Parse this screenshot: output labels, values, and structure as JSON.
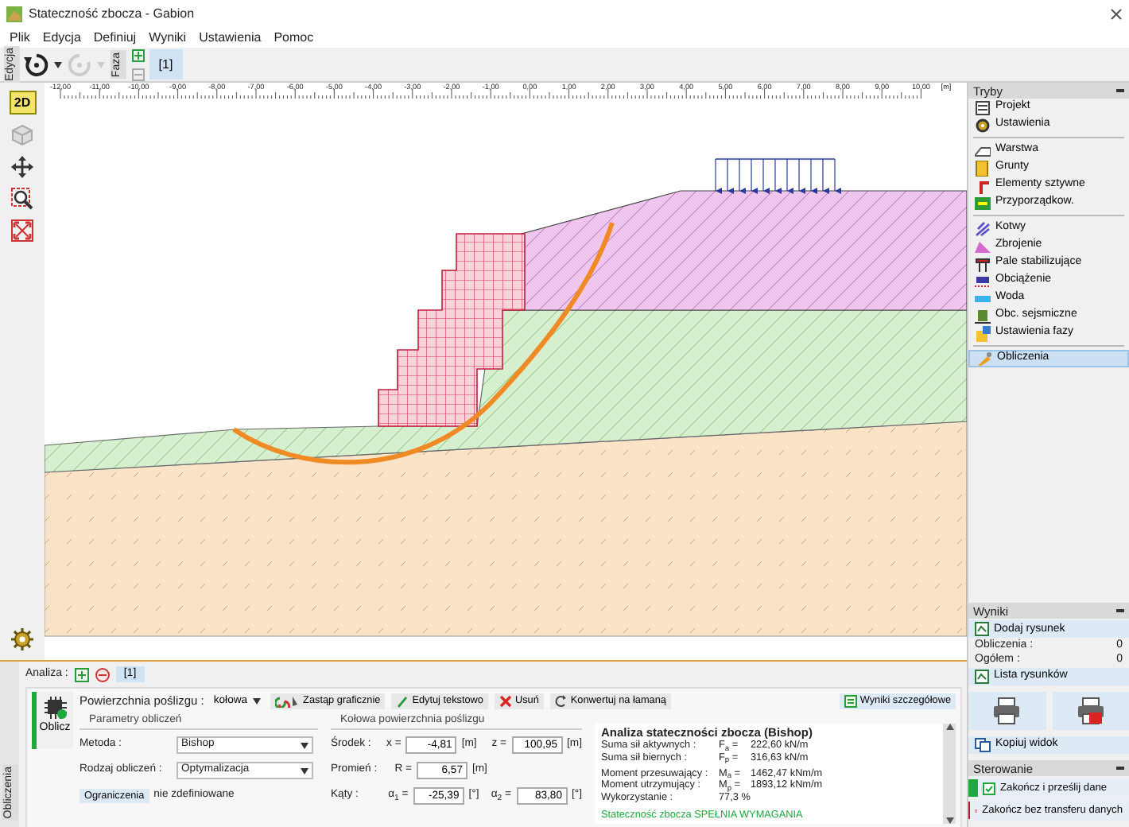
{
  "window": {
    "title": "Stateczność zbocza - Gabion"
  },
  "menu": [
    "Plik",
    "Edycja",
    "Definiuj",
    "Wyniki",
    "Ustawienia",
    "Pomoc"
  ],
  "toolbar": {
    "edit_label": "Edycja",
    "redo": {
      "disabled": true
    },
    "stage_label": "Faza",
    "stages": [
      {
        "label": "[1]",
        "selected": true
      }
    ]
  },
  "view_tools": {
    "mode": {
      "label": "2D",
      "selected": true
    }
  },
  "ruler": {
    "ticks": [
      "-12,00",
      "-11,00",
      "-10,00",
      "-9,00",
      "-8,00",
      "-7,00",
      "-6,00",
      "-5,00",
      "-4,00",
      "-3,00",
      "-2,00",
      "-1,00",
      "0,00",
      "1,00",
      "2,00",
      "3,00",
      "4,00",
      "5,00",
      "6,00",
      "7,00",
      "8,00",
      "9,00",
      "10,00"
    ],
    "unit": "[m]"
  },
  "sidebar": {
    "title": "Tryby",
    "groups": [
      [
        {
          "kind": "project",
          "label": "Projekt",
          "selected": false
        },
        {
          "kind": "settings",
          "label": "Ustawienia",
          "selected": false
        }
      ],
      [
        {
          "kind": "interface",
          "label": "Warstwa",
          "selected": false
        },
        {
          "kind": "soils",
          "label": "Grunty",
          "selected": false
        },
        {
          "kind": "rigid",
          "label": "Elementy sztywne",
          "selected": false
        },
        {
          "kind": "assign",
          "label": "Przyporządkow.",
          "selected": false
        }
      ],
      [
        {
          "kind": "anchors",
          "label": "Kotwy",
          "selected": false
        },
        {
          "kind": "reinforcement",
          "label": "Zbrojenie",
          "selected": false
        },
        {
          "kind": "piles",
          "label": "Pale stabilizujące",
          "selected": false
        },
        {
          "kind": "surcharge",
          "label": "Obciążenie",
          "selected": false
        },
        {
          "kind": "water",
          "label": "Woda",
          "selected": false
        },
        {
          "kind": "seismic",
          "label": "Obc. sejsmiczne",
          "selected": false
        },
        {
          "kind": "stage",
          "label": "Ustawienia fazy",
          "selected": false
        }
      ],
      [
        {
          "kind": "analysis",
          "label": "Obliczenia",
          "selected": true
        }
      ]
    ]
  },
  "results_panel": {
    "title": "Wyniki",
    "add_drawing": "Dodaj rysunek",
    "counts": [
      {
        "label": "Obliczenia :",
        "value": "0"
      },
      {
        "label": "Ogółem :",
        "value": "0"
      }
    ],
    "list_drawings": "Lista rysunków",
    "copy_view": "Kopiuj widok"
  },
  "control_panel": {
    "title": "Sterowanie",
    "buttons": [
      {
        "label": "Zakończ i prześlij dane",
        "color": "#1fa83c"
      },
      {
        "label": "Zakończ bez transferu danych",
        "color": "#a81f2a"
      }
    ]
  },
  "analysis": {
    "side_label": "Obliczenia",
    "label": "Analiza :",
    "tabs": [
      {
        "label": "[1]",
        "selected": true
      }
    ],
    "run_button": "Oblicz",
    "surface_label": "Powierzchnia poślizgu :",
    "surface_type": "kołowa",
    "actions": [
      {
        "kind": "replace",
        "label": "Zastąp graficznie"
      },
      {
        "kind": "edit",
        "label": "Edytuj tekstowo"
      },
      {
        "kind": "delete",
        "label": "Usuń"
      },
      {
        "kind": "convert",
        "label": "Konwertuj na łamaną"
      }
    ],
    "details_button": "Wyniki szczegółowe",
    "params": {
      "title": "Parametry obliczeń",
      "fields": [
        {
          "label": "Metoda :",
          "value": "Bishop"
        },
        {
          "label": "Rodzaj obliczeń :",
          "value": "Optymalizacja"
        }
      ],
      "limits_button": "Ograniczenia",
      "limits_value": "nie zdefiniowane"
    },
    "circle": {
      "title": "Kołowa powierzchnia poślizgu",
      "rows": [
        {
          "label": "Środek :",
          "fields": [
            {
              "symbol": "x =",
              "value": "-4,81",
              "unit": "[m]"
            },
            {
              "symbol": "z =",
              "value": "100,95",
              "unit": "[m]"
            }
          ]
        },
        {
          "label": "Promień :",
          "fields": [
            {
              "symbol": "R =",
              "value": "6,57",
              "unit": "[m]"
            }
          ]
        },
        {
          "label": "Kąty :",
          "fields": [
            {
              "symbol": "α$_{1}$ =",
              "value": "-25,39",
              "unit": "[°]"
            },
            {
              "symbol": "α$_{2}$ =",
              "value": "83,80",
              "unit": "[°]"
            }
          ]
        }
      ]
    },
    "output": {
      "title": "Analiza stateczności zbocza (Bishop)",
      "blocks": [
        [
          {
            "label": "Suma sił aktywnych :",
            "symbol": "F$_{a}$ =",
            "value": "222,60 kN/m"
          },
          {
            "label": "Suma sił biernych :",
            "symbol": "F$_{p}$ =",
            "value": "316,63 kN/m"
          }
        ],
        [
          {
            "label": "Moment przesuwający :",
            "symbol": "M$_{a}$ =",
            "value": "1462,47 kNm/m"
          },
          {
            "label": "Moment utrzymujący :",
            "symbol": "M$_{p}$ =",
            "value": "1893,12 kNm/m"
          },
          {
            "label": "Wykorzystanie :",
            "value": "77,3 %"
          }
        ]
      ],
      "verdict": "Stateczność zbocza SPEŁNIA WYMAGANIA"
    }
  }
}
